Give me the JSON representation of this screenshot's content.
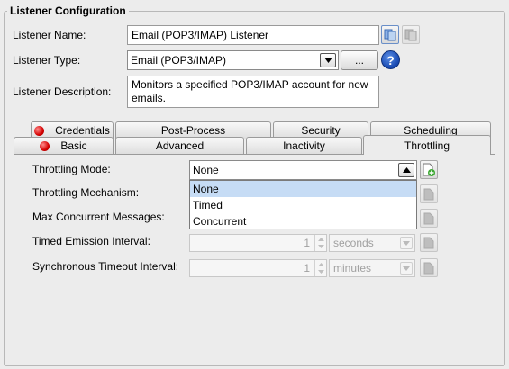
{
  "group": {
    "title": "Listener Configuration"
  },
  "listener": {
    "name_label": "Listener Name:",
    "name_value": "Email (POP3/IMAP) Listener",
    "type_label": "Listener Type:",
    "type_value": "Email (POP3/IMAP)",
    "browse_label": "...",
    "description_label": "Listener Description:",
    "description_value": "Monitors a specified POP3/IMAP account for new emails."
  },
  "tabs": {
    "row1": [
      "Credentials",
      "Post-Process",
      "Security",
      "Scheduling"
    ],
    "row2": [
      "Basic",
      "Advanced",
      "Inactivity",
      "Throttling"
    ],
    "selected": "Throttling"
  },
  "throttling": {
    "mode_label": "Throttling Mode:",
    "mode_value": "None",
    "mechanism_label": "Throttling Mechanism:",
    "max_label": "Max Concurrent Messages:",
    "timed_label": "Timed Emission Interval:",
    "timed_value": "1",
    "timed_unit": "seconds",
    "sync_label": "Synchronous Timeout Interval:",
    "sync_value": "1",
    "sync_unit": "minutes",
    "options": [
      "None",
      "Timed",
      "Concurrent"
    ],
    "highlighted_option": "None"
  }
}
